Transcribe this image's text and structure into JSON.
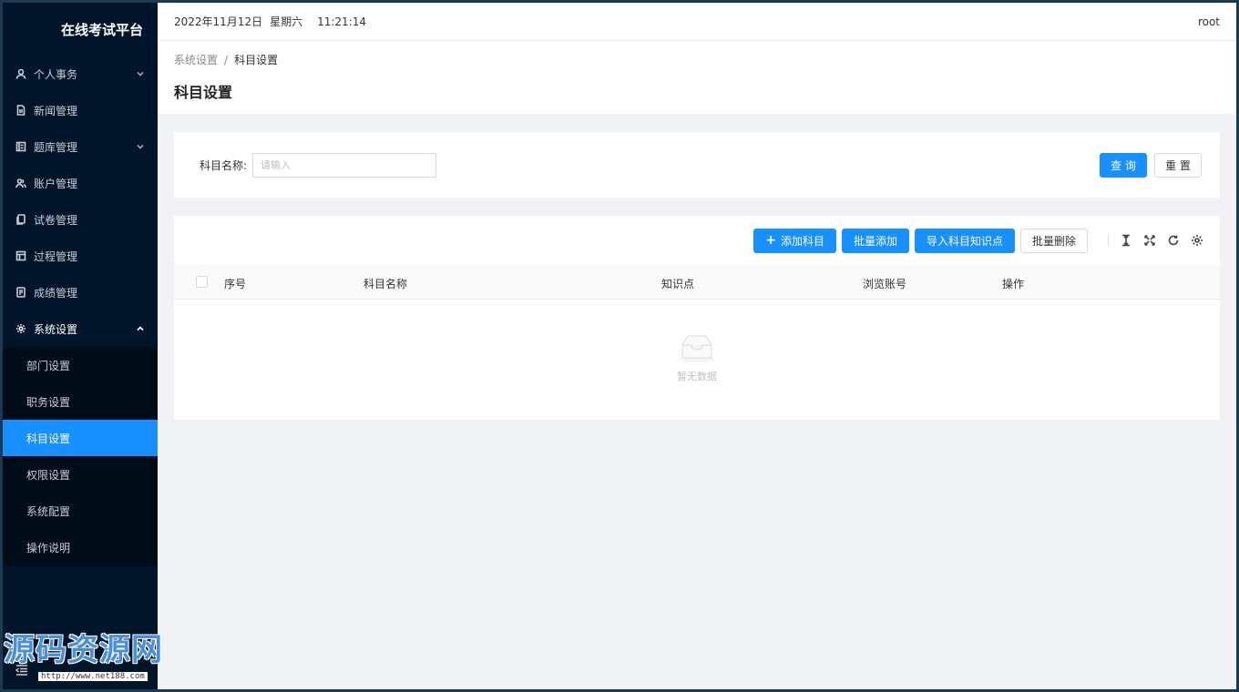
{
  "app": {
    "title": "在线考试平台"
  },
  "sidebar": {
    "items": [
      {
        "label": "个人事务",
        "icon": "user-icon",
        "has_children": true
      },
      {
        "label": "新闻管理",
        "icon": "file-icon",
        "has_children": false
      },
      {
        "label": "题库管理",
        "icon": "list-icon",
        "has_children": true
      },
      {
        "label": "账户管理",
        "icon": "users-icon",
        "has_children": false
      },
      {
        "label": "试卷管理",
        "icon": "copy-icon",
        "has_children": false
      },
      {
        "label": "过程管理",
        "icon": "layout-icon",
        "has_children": false
      },
      {
        "label": "成绩管理",
        "icon": "doc-icon",
        "has_children": false
      },
      {
        "label": "系统设置",
        "icon": "gear-icon",
        "has_children": true,
        "open": true
      }
    ],
    "sub_items": [
      {
        "label": "部门设置"
      },
      {
        "label": "职务设置"
      },
      {
        "label": "科目设置",
        "active": true
      },
      {
        "label": "权限设置"
      },
      {
        "label": "系统配置"
      },
      {
        "label": "操作说明"
      }
    ]
  },
  "topbar": {
    "date": "2022年11月12日",
    "weekday": "星期六",
    "time": "11:21:14",
    "user": "root"
  },
  "breadcrumb": {
    "parent": "系统设置",
    "separator": "/",
    "current": "科目设置"
  },
  "page": {
    "title": "科目设置"
  },
  "search": {
    "label": "科目名称:",
    "placeholder": "请输入",
    "query_label": "查 询",
    "reset_label": "重 置"
  },
  "toolbar": {
    "add_label": "添加科目",
    "batch_add_label": "批量添加",
    "import_label": "导入科目知识点",
    "batch_delete_label": "批量删除"
  },
  "table": {
    "columns": [
      "序号",
      "科目名称",
      "知识点",
      "浏览账号",
      "操作"
    ],
    "empty_text": "暂无数据"
  },
  "watermark": {
    "text": "源码资源网",
    "url": "http://www.net188.com"
  },
  "colors": {
    "primary": "#1890ff",
    "sidebar_bg": "#001529",
    "submenu_bg": "#000c17"
  }
}
